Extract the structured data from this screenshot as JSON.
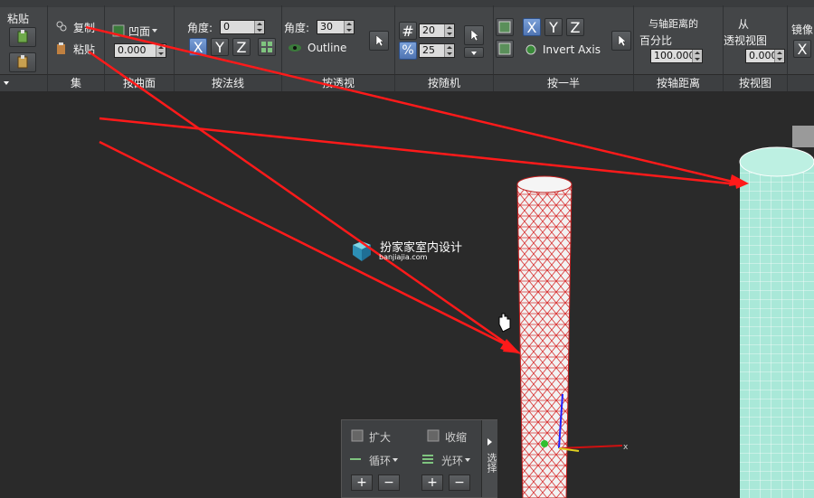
{
  "ribbon": {
    "paste_group": {
      "title": "粘贴",
      "label": ""
    },
    "set_group": {
      "copy_label": "复制",
      "paste_label": "粘贴",
      "label": "集"
    },
    "surface_group": {
      "dropdown_value": "凹面",
      "offset_value": "0.000",
      "label": "按曲面"
    },
    "normal_group": {
      "angle_label": "角度:",
      "angle_value": "0",
      "axes": [
        "X",
        "Y",
        "Z"
      ],
      "label": "按法线"
    },
    "view_group": {
      "angle_label": "角度:",
      "angle_value": "30",
      "outline_label": "Outline",
      "label": "按透视"
    },
    "random_group": {
      "value1": "20",
      "value2": "25",
      "label": "按随机"
    },
    "half_group": {
      "axes": [
        "X",
        "Y",
        "Z"
      ],
      "invert_label": "Invert Axis",
      "label": "按一半"
    },
    "pivot_group": {
      "title_line1": "与轴距离的",
      "title_line2": "百分比",
      "value": "100.000",
      "label": "按轴距离"
    },
    "perspective_group": {
      "title_line1": "从",
      "title_line2": "透视视图",
      "value": "0.000",
      "label": "按视图"
    },
    "mirror_group": {
      "title": "镜像",
      "axis": "X"
    }
  },
  "watermark": {
    "title": "扮家家室内设计",
    "subtitle": "banjiajia.com"
  },
  "floating_panel": {
    "grow_label": "扩大",
    "shrink_label": "收缩",
    "loop_label": "循环",
    "ring_label": "光环",
    "side_label": "选择"
  },
  "colors": {
    "accent": "#4a6ea8",
    "arrow": "#ff1a1a",
    "mesh_red": "#e03030",
    "mesh_cyan": "#9fe3d3"
  }
}
